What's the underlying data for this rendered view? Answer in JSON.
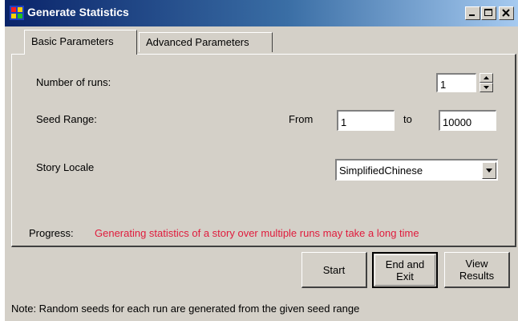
{
  "window": {
    "title": "Generate Statistics",
    "controls": [
      "minimize-icon",
      "maximize-icon",
      "close-icon"
    ]
  },
  "tabs": [
    {
      "label": "Basic Parameters",
      "selected": true
    },
    {
      "label": "Advanced Parameters",
      "selected": false
    }
  ],
  "basic": {
    "runs_label": "Number of runs:",
    "runs_value": "1",
    "seed_label": "Seed Range:",
    "from_label": "From",
    "seed_from": "1",
    "to_label": "to",
    "seed_to": "10000",
    "locale_label": "Story Locale",
    "locale_value": "SimplifiedChinese",
    "progress_label": "Progress:",
    "progress_message": "Generating statistics of a story over multiple runs may take a long time"
  },
  "buttons": {
    "start": "Start",
    "end_exit_line1": "End and",
    "end_exit_line2": "Exit",
    "view_results_line1": "View",
    "view_results_line2": "Results"
  },
  "note": "Note: Random seeds for each run are generated from the given seed range",
  "colors": {
    "titlebar_start": "#0a246a",
    "titlebar_end": "#a6caf0",
    "progress_message": "#e01b3c",
    "face": "#d4d0c8"
  }
}
